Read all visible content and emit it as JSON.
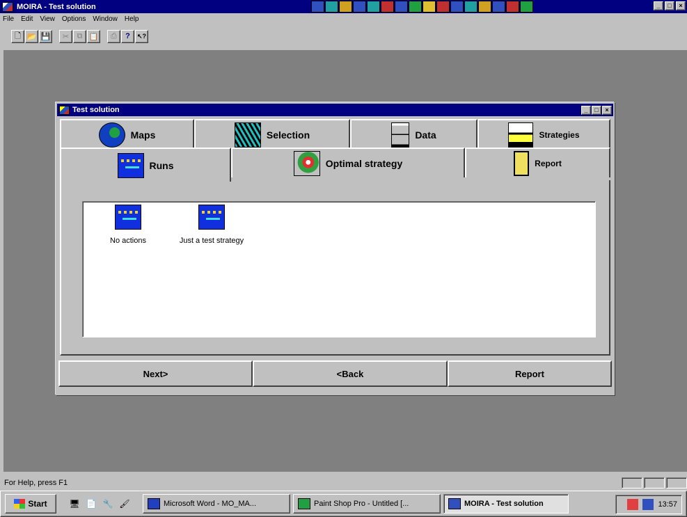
{
  "app": {
    "title": "MOIRA - Test solution",
    "menu": [
      "File",
      "Edit",
      "View",
      "Options",
      "Window",
      "Help"
    ],
    "toolbar": [
      {
        "name": "new-icon",
        "glyph": "🗋"
      },
      {
        "name": "open-icon",
        "glyph": "📂"
      },
      {
        "name": "save-icon",
        "glyph": "💾"
      },
      {
        "name": "cut-icon",
        "glyph": "✂"
      },
      {
        "name": "copy-icon",
        "glyph": "⧉"
      },
      {
        "name": "paste-icon",
        "glyph": "📋"
      },
      {
        "name": "print-icon",
        "glyph": "⎙"
      },
      {
        "name": "help-icon",
        "glyph": "?"
      },
      {
        "name": "context-help-icon",
        "glyph": "↖?"
      }
    ]
  },
  "child": {
    "title": "Test solution",
    "tabs_row1": [
      "Maps",
      "Selection",
      "Data",
      "Strategies"
    ],
    "tabs_row2": [
      "Runs",
      "Optimal strategy",
      "Report"
    ],
    "active_tab": "Runs",
    "runs": [
      "No actions",
      "Just a test strategy"
    ],
    "buttons": {
      "next": "Next>",
      "back": "<Back",
      "report": "Report"
    }
  },
  "status": {
    "text": "For Help, press F1"
  },
  "taskbar": {
    "start": "Start",
    "tasks": [
      "Microsoft Word - MO_MA...",
      "Paint Shop Pro - Untitled [...",
      "MOIRA - Test solution"
    ],
    "clock": "13:57"
  }
}
